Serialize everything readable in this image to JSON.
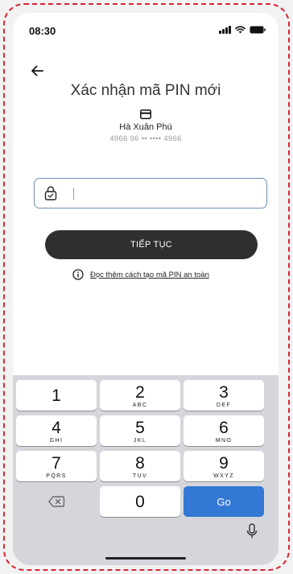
{
  "status_bar": {
    "time": "08:30"
  },
  "header": {
    "title": "Xác nhận mã PIN mới"
  },
  "account": {
    "holder_name": "Hà Xuân Phú",
    "card_number": "4966  96 ••  ••••  4966"
  },
  "pin_input": {
    "value": "",
    "placeholder": ""
  },
  "continue_button": {
    "label": "TIẾP TỤC"
  },
  "tip": {
    "link_text": "Đọc thêm cách tạo mã PIN an toàn"
  },
  "keypad": {
    "keys": [
      {
        "num": "1",
        "letters": ""
      },
      {
        "num": "2",
        "letters": "ABC"
      },
      {
        "num": "3",
        "letters": "DEF"
      },
      {
        "num": "4",
        "letters": "GHI"
      },
      {
        "num": "5",
        "letters": "JKL"
      },
      {
        "num": "6",
        "letters": "MNO"
      },
      {
        "num": "7",
        "letters": "PQRS"
      },
      {
        "num": "8",
        "letters": "TUV"
      },
      {
        "num": "9",
        "letters": "WXYZ"
      }
    ],
    "zero": "0",
    "go_label": "Go"
  },
  "colors": {
    "frame_dash": "#d9262e",
    "primary_button": "#2f2f2f",
    "input_border": "#6f8fb0",
    "keyboard_bg": "#d4d6dc",
    "go_key": "#3478d6"
  },
  "icons": [
    "back-arrow-icon",
    "card-icon",
    "lock-icon",
    "info-icon",
    "backspace-icon",
    "mic-icon",
    "signal-icon",
    "wifi-icon",
    "battery-icon"
  ]
}
